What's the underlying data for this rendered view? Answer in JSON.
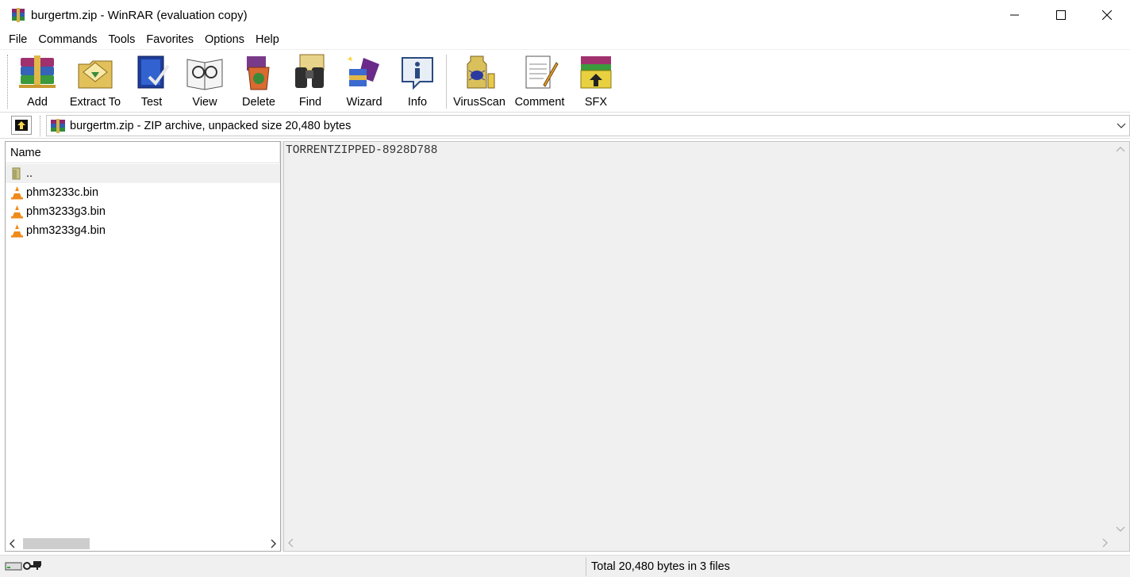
{
  "window": {
    "title": "burgertm.zip - WinRAR (evaluation copy)"
  },
  "menu": [
    "File",
    "Commands",
    "Tools",
    "Favorites",
    "Options",
    "Help"
  ],
  "toolbar": {
    "add": "Add",
    "extract_to": "Extract To",
    "test": "Test",
    "view": "View",
    "delete": "Delete",
    "find": "Find",
    "wizard": "Wizard",
    "info": "Info",
    "virusscan": "VirusScan",
    "comment": "Comment",
    "sfx": "SFX"
  },
  "address": {
    "text": "burgertm.zip - ZIP archive, unpacked size 20,480 bytes"
  },
  "file_list": {
    "column_name": "Name",
    "rows": [
      "..",
      "phm3233c.bin",
      "phm3233g3.bin",
      "phm3233g4.bin"
    ]
  },
  "comment_pane": {
    "text": "TORRENTZIPPED-8928D788"
  },
  "status": {
    "total": "Total 20,480 bytes in 3 files"
  },
  "icons": {
    "app": "winrar-books-icon",
    "file": "vlc-cone-icon",
    "parent": "folder-up-icon"
  }
}
